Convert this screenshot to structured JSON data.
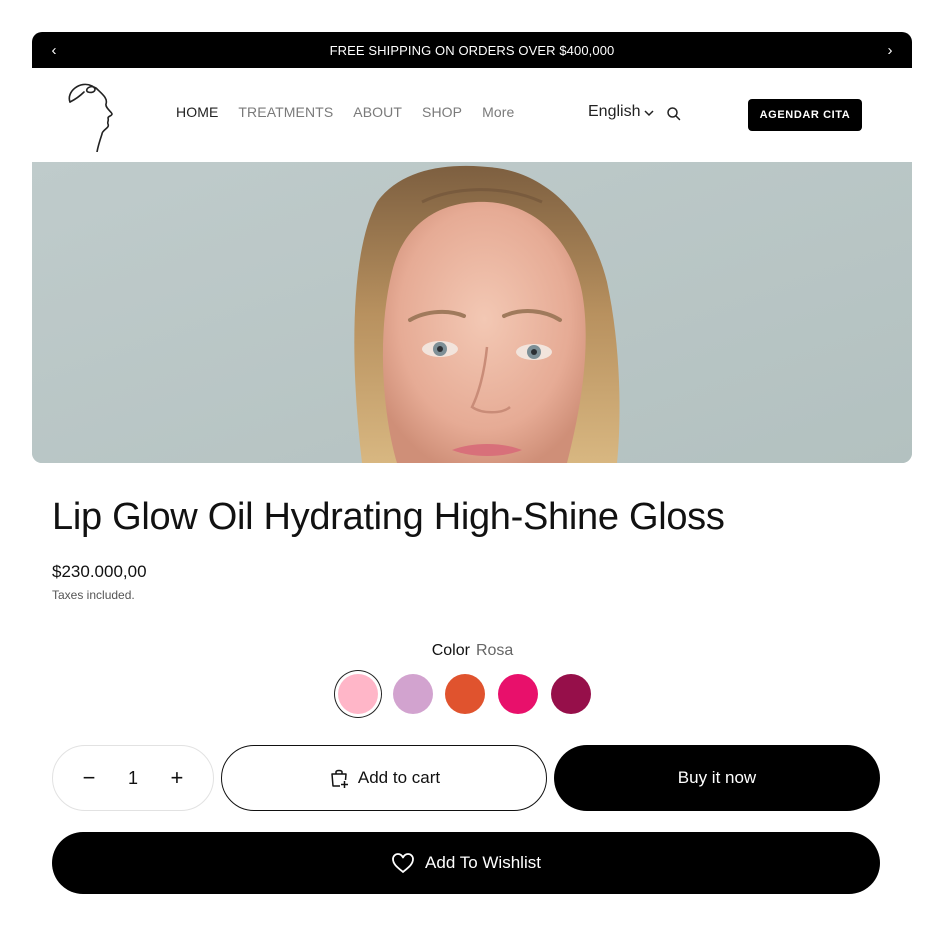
{
  "announcement": {
    "text": "FREE SHIPPING ON ORDERS OVER $400,000",
    "prev_icon": "chevron-left-icon",
    "next_icon": "chevron-right-icon",
    "prev_glyph": "‹",
    "next_glyph": "›"
  },
  "header": {
    "logo_icon": "face-profile-line-logo",
    "nav": {
      "home": "HOME",
      "treatments": "TREATMENTS",
      "about": "ABOUT",
      "shop": "SHOP",
      "more": "More"
    },
    "language": "English",
    "language_icon": "chevron-down-icon",
    "search_icon": "search-icon",
    "cta_label": "AGENDAR CITA"
  },
  "hero": {
    "image": "woman-portrait-photo",
    "background_color": "#b9c5c4"
  },
  "product": {
    "title": "Lip Glow Oil Hydrating High-Shine Gloss",
    "price": "$230.000,00",
    "tax_note": "Taxes included.",
    "color_label": "Color",
    "color_value": "Rosa",
    "swatches": [
      {
        "name": "Rosa",
        "color": "#ffb6c8",
        "selected": true
      },
      {
        "name": "lilac",
        "color": "#d2a3cf",
        "selected": false
      },
      {
        "name": "coral",
        "color": "#e0532e",
        "selected": false
      },
      {
        "name": "fuchsia",
        "color": "#e8106b",
        "selected": false
      },
      {
        "name": "berry",
        "color": "#960f4a",
        "selected": false
      }
    ],
    "quantity": "1",
    "minus_glyph": "−",
    "plus_glyph": "+",
    "add_to_cart_label": "Add to cart",
    "add_to_cart_icon": "shopping-bag-plus-icon",
    "buy_now_label": "Buy it now",
    "wishlist_label": "Add To Wishlist",
    "wishlist_icon": "heart-outline-icon"
  }
}
